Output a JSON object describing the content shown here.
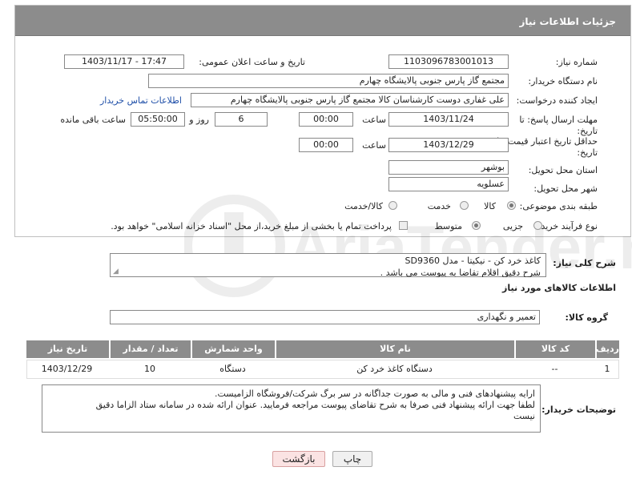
{
  "header": {
    "title": "جزئیات اطلاعات نیاز"
  },
  "fields": {
    "need_number_label": "شماره نیاز:",
    "need_number": "1103096783001013",
    "announce_label": "تاریخ و ساعت اعلان عمومی:",
    "announce_value": "1403/11/17 - 17:47",
    "buyer_org_label": "نام دستگاه خریدار:",
    "buyer_org": "مجتمع گاز پارس جنوبی  پالایشگاه چهارم",
    "creator_label": "ایجاد کننده درخواست:",
    "creator": "علی غفاری دوست کارشناسان کالا مجتمع گاز پارس جنوبی  پالایشگاه چهارم",
    "contact_link": "اطلاعات تماس خریدار",
    "deadline_label": "مهلت ارسال پاسخ: تا تاریخ:",
    "deadline_date": "1403/11/24",
    "time_label": "ساعت",
    "deadline_time": "00:00",
    "days_value": "6",
    "days_label": "روز و",
    "remaining_value": "05:50:00",
    "remaining_label": "ساعت باقی مانده",
    "validity_label": "حداقل تاریخ اعتبار قیمت: تا تاریخ:",
    "validity_date": "1403/12/29",
    "validity_time": "00:00",
    "province_label": "استان محل تحویل:",
    "province": "بوشهر",
    "city_label": "شهر محل تحویل:",
    "city": "عسلویه",
    "category_label": "طبقه بندی موضوعی:",
    "category_options": [
      "کالا",
      "خدمت",
      "کالا/خدمت"
    ],
    "process_label": "نوع فرآیند خرید :",
    "process_options": [
      "جزیی",
      "متوسط"
    ],
    "payment_note": "پرداخت تمام یا بخشی از مبلغ خرید،از محل \"اسناد خزانه اسلامی\" خواهد بود."
  },
  "description": {
    "label": "شرح کلی نیاز:",
    "line1": "کاغذ خرد کن - نیکیتا - مدل SD9360",
    "line2": "شرح دقیق اقلام تقاضا به پیوست می باشد ."
  },
  "goods_section_title": "اطلاعات کالاهای مورد نیاز",
  "goods_group": {
    "label": "گروه کالا:",
    "value": "تعمیر و نگهداری"
  },
  "table": {
    "headers": [
      "ردیف",
      "کد کالا",
      "نام کالا",
      "واحد شمارش",
      "تعداد / مقدار",
      "تاریخ نیاز"
    ],
    "rows": [
      {
        "index": "1",
        "code": "--",
        "name": "دستگاه کاغذ خرد کن",
        "unit": "دستگاه",
        "qty": "10",
        "date": "1403/12/29"
      }
    ]
  },
  "buyer_notes": {
    "label": "توضیحات خریدار:",
    "line1": "ارایه پیشنهادهای فنی و مالی به صورت جداگانه در سر برگ شرکت/فروشگاه الزامیست.",
    "line2": "لطفا جهت ارائه پیشنهاد فنی صرفا به شرح تقاضای پیوست مراجعه فرمایید. عنوان ارائه شده در سامانه ستاد الزاما دقیق",
    "line3": "نیست"
  },
  "buttons": {
    "print": "چاپ",
    "back": "بازگشت"
  },
  "watermark_text": "AriaTender.neT"
}
